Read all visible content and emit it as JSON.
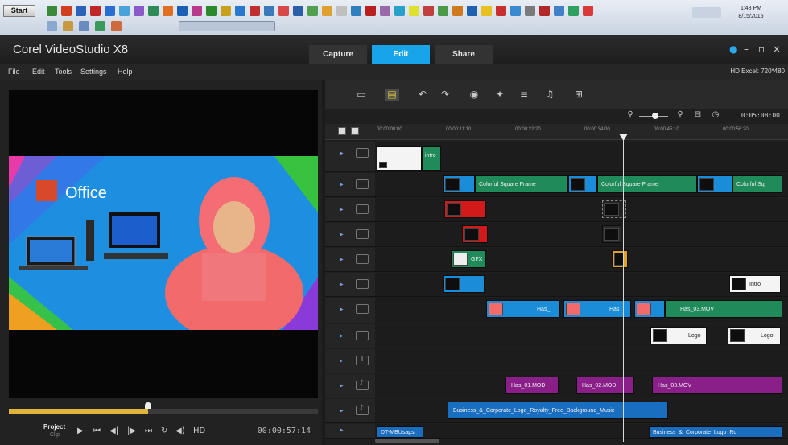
{
  "taskbar": {
    "start_label": "Start",
    "clock_time": "1:48 PM",
    "clock_date": "8/15/2015"
  },
  "app": {
    "title": "Corel VideoStudio X8",
    "tabs": [
      {
        "label": "Capture",
        "active": false
      },
      {
        "label": "Edit",
        "active": true
      },
      {
        "label": "Share",
        "active": false
      }
    ],
    "accent_color": "#17a4e8"
  },
  "menu": {
    "items": [
      "File",
      "Edit",
      "Tools",
      "Settings",
      "Help"
    ],
    "project_info": "HD Excel: 720*480"
  },
  "player": {
    "video_title": "Office",
    "project_label": "Project",
    "clip_label": "Clip",
    "timecode": "00:00:57:14",
    "progress": 0.45
  },
  "timeline": {
    "duration": "0:05:08:00",
    "ruler": [
      "00:00:00:00",
      "00:00:11:10",
      "00:00:22:20",
      "00:00:34:00",
      "00:00:45:10",
      "00:00:56:20"
    ],
    "clips": {
      "intro": "intro",
      "frame1": "Colorful Square Frame",
      "frame2": "Colorful Square Frame",
      "frame3": "Colorful Sq",
      "gfx": "GFX",
      "mov1": "Has_",
      "mov2": "Has",
      "mov3": "Has_03.MOV",
      "logo1": "Logo",
      "logo2": "Logo",
      "white_short": "Intro",
      "voice1": "Has_01.MOD",
      "voice2": "Has_02.MOD",
      "voice3": "Has_03.MOV",
      "music1": "Business_&_Corporate_Logo_Royalty_Free_Background_Music",
      "music2": "DT-MBUsaps",
      "music3": "Business_&_Corporate_Logo_Ro"
    }
  }
}
